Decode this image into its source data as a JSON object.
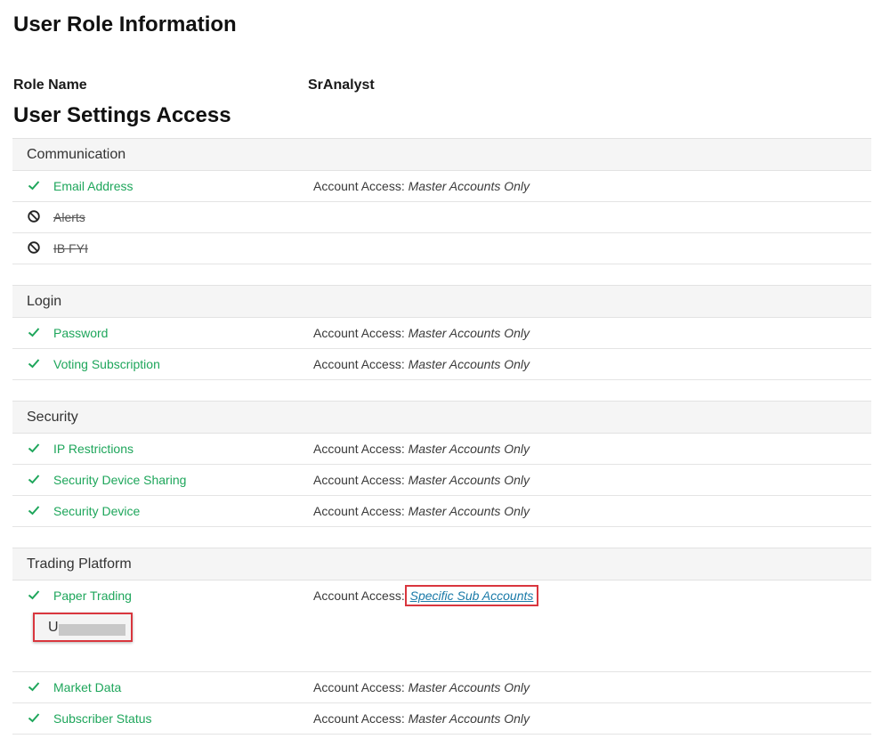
{
  "page": {
    "title": "User Role Information",
    "role_label": "Role Name",
    "role_value": "SrAnalyst",
    "settings_title": "User Settings Access"
  },
  "colors": {
    "enabled": "#1ea65b",
    "highlight": "#d9363e",
    "link": "#1a7aa8"
  },
  "access_prefix": "Account Access: ",
  "sections": {
    "communication": {
      "title": "Communication",
      "items": [
        {
          "label": "Email Address",
          "status": "enabled",
          "access": "Master Accounts Only"
        },
        {
          "label": "Alerts",
          "status": "disabled"
        },
        {
          "label": "IB FYI",
          "status": "disabled"
        }
      ]
    },
    "login": {
      "title": "Login",
      "items": [
        {
          "label": "Password",
          "status": "enabled",
          "access": "Master Accounts Only"
        },
        {
          "label": "Voting Subscription",
          "status": "enabled",
          "access": "Master Accounts Only"
        }
      ]
    },
    "security": {
      "title": "Security",
      "items": [
        {
          "label": "IP Restrictions",
          "status": "enabled",
          "access": "Master Accounts Only"
        },
        {
          "label": "Security Device Sharing",
          "status": "enabled",
          "access": "Master Accounts Only"
        },
        {
          "label": "Security Device",
          "status": "enabled",
          "access": "Master Accounts Only"
        }
      ]
    },
    "trading": {
      "title": "Trading Platform",
      "items": [
        {
          "label": "Paper Trading",
          "status": "enabled",
          "access": "Specific Sub Accounts",
          "sub_account_prefix": "U"
        },
        {
          "label": "Market Data",
          "status": "enabled",
          "access": "Master Accounts Only"
        },
        {
          "label": "Subscriber Status",
          "status": "enabled",
          "access": "Master Accounts Only"
        }
      ]
    }
  }
}
